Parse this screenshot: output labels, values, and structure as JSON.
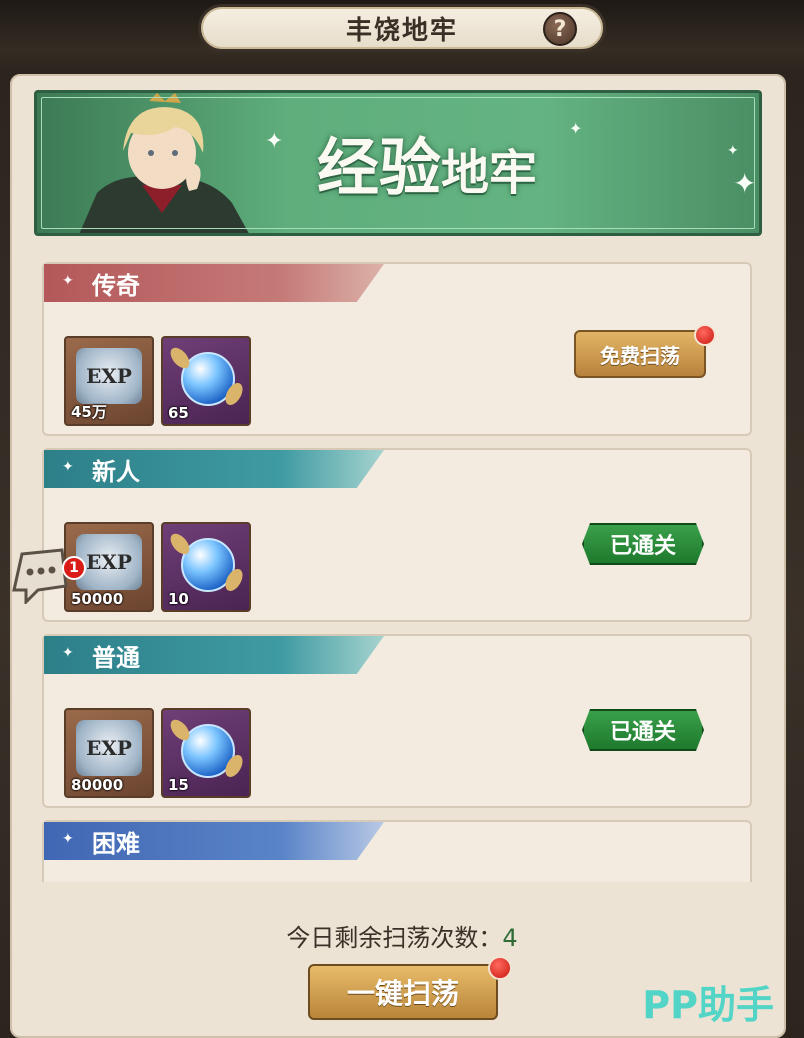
{
  "header": {
    "title": "丰饶地牢",
    "help_symbol": "?"
  },
  "banner": {
    "title_big": "经验",
    "title_small": "地牢"
  },
  "dungeons": [
    {
      "name": "传奇",
      "rewards": {
        "exp": "45万",
        "orb": "65"
      },
      "action": "免费扫荡",
      "action_type": "sweep",
      "has_dot": true
    },
    {
      "name": "新人",
      "rewards": {
        "exp": "50000",
        "orb": "10"
      },
      "action": "已通关",
      "action_type": "cleared",
      "has_dot": false
    },
    {
      "name": "普通",
      "rewards": {
        "exp": "80000",
        "orb": "15"
      },
      "action": "已通关",
      "action_type": "cleared",
      "has_dot": false
    },
    {
      "name": "困难"
    }
  ],
  "chat": {
    "badge_count": "1"
  },
  "footer": {
    "remain_label": "今日剩余扫荡次数：",
    "remain_count": "4",
    "sweep_all_label": "一键扫荡"
  },
  "exp_icon_text": "EXP",
  "watermark": "PP助手",
  "colors": {
    "panel_bg": "#ece3d4",
    "banner_green": "#5fae7c",
    "cleared_green": "#1e7a2d",
    "gold_button": "#c8954a",
    "alert_red": "#d91c17"
  }
}
